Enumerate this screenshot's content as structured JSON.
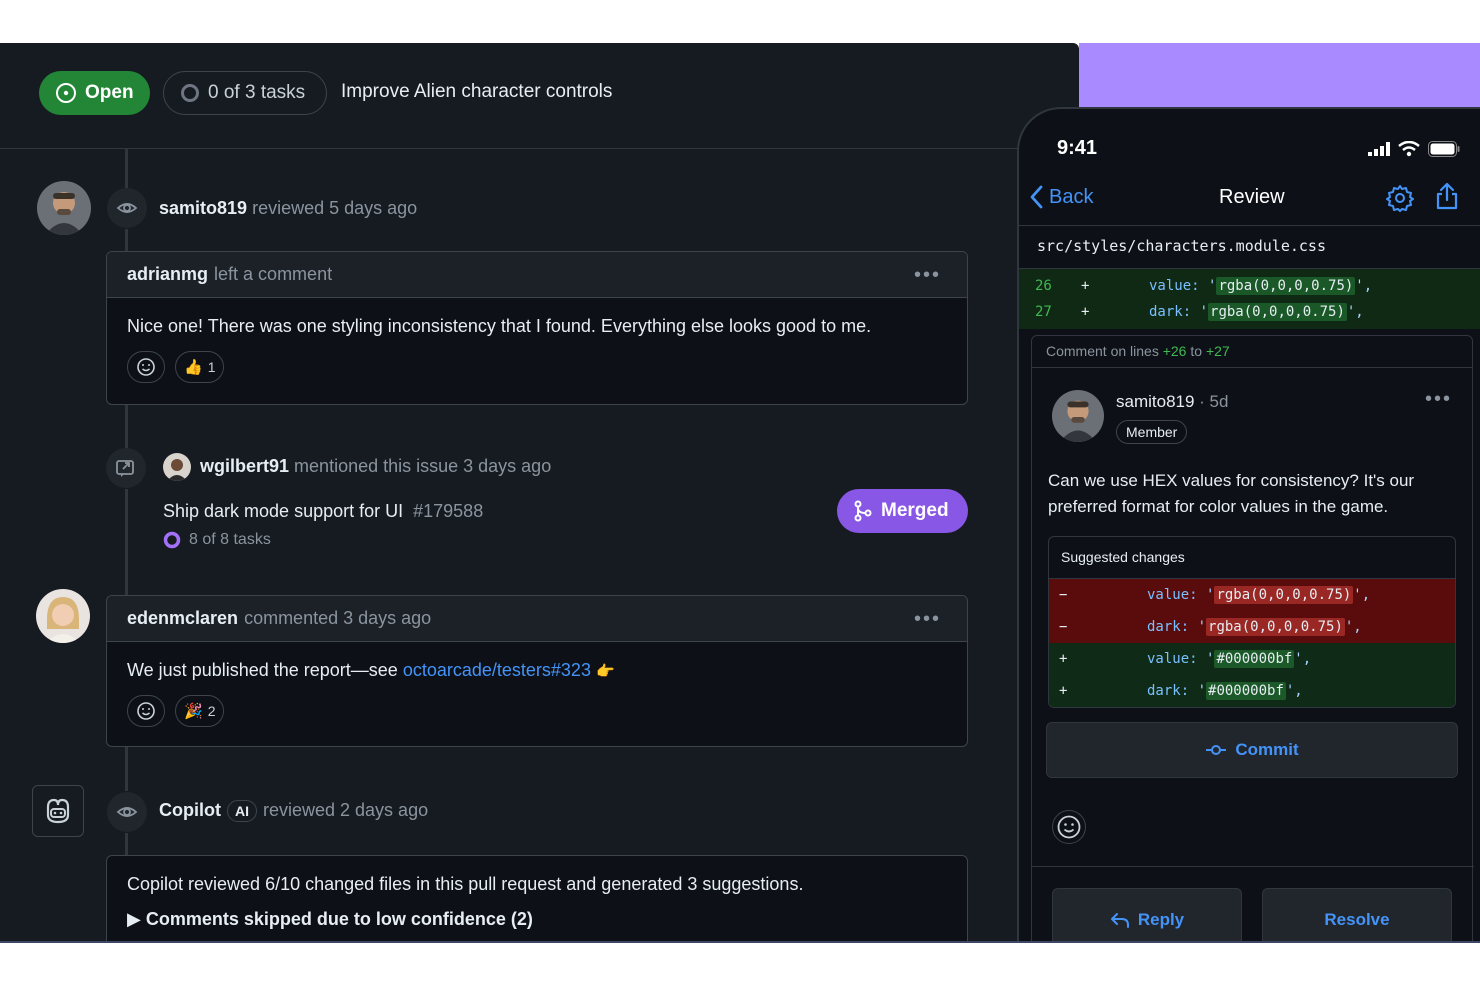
{
  "header": {
    "status_label": "Open",
    "tasks_label": "0 of 3 tasks",
    "issue_title": "Improve Alien character controls"
  },
  "timeline": {
    "review1": {
      "author": "samito819",
      "action": "reviewed 5 days ago"
    },
    "comment1": {
      "author": "adrianmg",
      "action": "left a comment",
      "body": "Nice one! There was one styling inconsistency that I found. Everything else looks good to me.",
      "reaction_count": "1"
    },
    "mention": {
      "author": "wgilbert91",
      "action": "mentioned this issue 3 days ago",
      "pr_title": "Ship dark mode support for UI",
      "pr_number": "#179588",
      "pr_tasks": "8 of 8 tasks",
      "status_label": "Merged"
    },
    "comment2": {
      "author": "edenmclaren",
      "action": "commented 3 days ago",
      "body_prefix": "We just published the report—see ",
      "link_text": "octoarcade/testers#323",
      "reaction_count": "2"
    },
    "review2": {
      "author": "Copilot",
      "badge": "AI",
      "action": "reviewed 2 days ago",
      "body": "Copilot reviewed 6/10 changed files in this pull request and generated 3 suggestions.",
      "details": "▶ Comments skipped due to low confidence (2)"
    }
  },
  "phone": {
    "time": "9:41",
    "back_label": "Back",
    "title": "Review",
    "file_path": "src/styles/characters.module.css",
    "diff": [
      {
        "line": "26",
        "sign": "+",
        "key": "value:",
        "value": "rgba(0,0,0,0.75)"
      },
      {
        "line": "27",
        "sign": "+",
        "key": "dark:",
        "value": "rgba(0,0,0,0.75)"
      }
    ],
    "thread": {
      "range_prefix": "Comment on lines ",
      "range_start": "+26",
      "range_to": " to ",
      "range_end": "+27",
      "author": "samito819",
      "age": "· 5d",
      "badge": "Member",
      "body": "Can we use HEX values for consistency? It's our preferred format for color values in the game.",
      "suggested_title": "Suggested changes",
      "suggestions": [
        {
          "sign": "−",
          "key": "value:",
          "value": "rgba(0,0,0,0.75)",
          "type": "del"
        },
        {
          "sign": "−",
          "key": "dark:",
          "value": "rgba(0,0,0,0.75)",
          "type": "del"
        },
        {
          "sign": "+",
          "key": "value:",
          "value": "#000000bf",
          "type": "add"
        },
        {
          "sign": "+",
          "key": "dark:",
          "value": "#000000bf",
          "type": "add"
        }
      ],
      "commit_label": "Commit",
      "reply_label": "Reply",
      "resolve_label": "Resolve"
    }
  },
  "colors": {
    "open_green": "#238636",
    "merged_purple": "#8957e5",
    "link_blue": "#4493f8",
    "background_accent": "#a98bff"
  }
}
